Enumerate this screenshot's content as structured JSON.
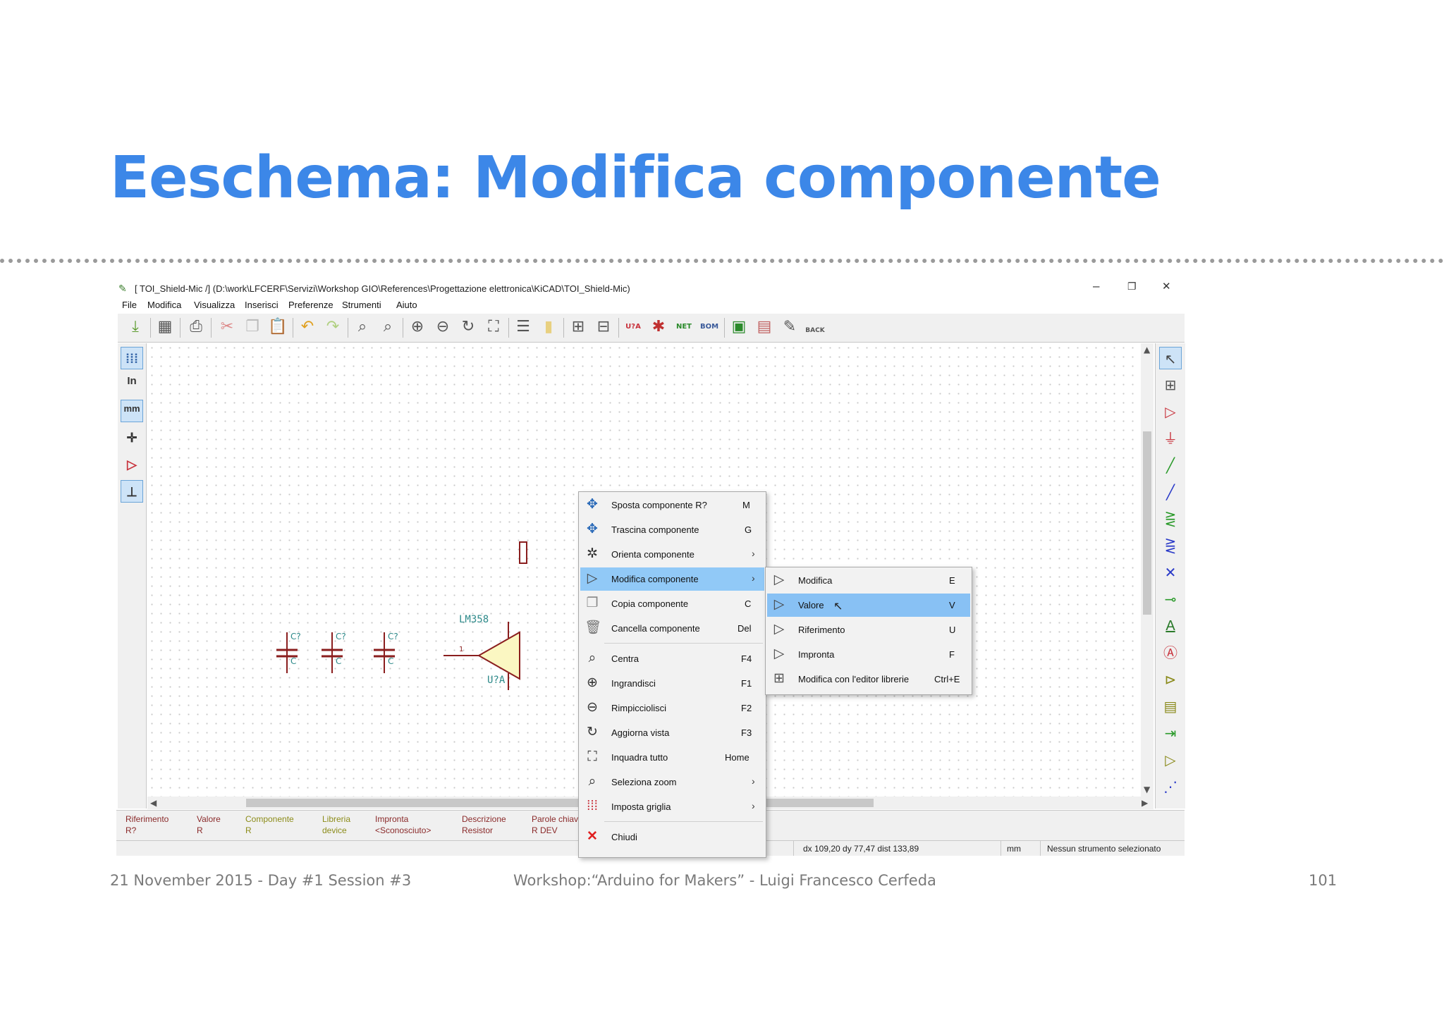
{
  "slide": {
    "title": "Eeschema: Modifica componente",
    "footer_left": "21 November 2015 - Day #1 Session #3",
    "footer_center": "Workshop:“Arduino for Makers” - Luigi Francesco Cerfeda",
    "footer_right": "101"
  },
  "window": {
    "title": "[ TOI_Shield-Mic /] (D:\\work\\LFCERF\\Servizi\\Workshop GIO\\References\\Progettazione elettronica\\KiCAD\\TOI_Shield-Mic)",
    "minimize": "–",
    "restore": "❐",
    "close": "✕"
  },
  "menubar": [
    "File",
    "Modifica",
    "Visualizza",
    "Inserisci",
    "Preferenze",
    "Strumenti",
    "Aiuto"
  ],
  "toolbar": {
    "netlist_label": "NET",
    "bom_label": "BOM",
    "back_label": "BACK",
    "annotate_label": "U?A"
  },
  "left_toolbar": {
    "units_in": "In",
    "units_mm": "mm"
  },
  "schematic": {
    "caps": [
      {
        "ref": "C?",
        "value": "C"
      },
      {
        "ref": "C?",
        "value": "C"
      },
      {
        "ref": "C?",
        "value": "C"
      }
    ],
    "opamp_value": "LM358",
    "opamp_ref": "U?A",
    "pin_number": "1"
  },
  "context_menu": {
    "items": [
      {
        "label": "Sposta componente R?",
        "shortcut": "M"
      },
      {
        "label": "Trascina componente",
        "shortcut": "G"
      },
      {
        "label": "Orienta componente",
        "shortcut": "›"
      },
      {
        "label": "Modifica componente",
        "shortcut": "›"
      },
      {
        "label": "Copia componente",
        "shortcut": "C"
      },
      {
        "label": "Cancella componente",
        "shortcut": "Del"
      },
      {
        "label": "Centra",
        "shortcut": "F4"
      },
      {
        "label": "Ingrandisci",
        "shortcut": "F1"
      },
      {
        "label": "Rimpicciolisci",
        "shortcut": "F2"
      },
      {
        "label": "Aggiorna vista",
        "shortcut": "F3"
      },
      {
        "label": "Inquadra tutto",
        "shortcut": "Home"
      },
      {
        "label": "Seleziona zoom",
        "shortcut": "›"
      },
      {
        "label": "Imposta griglia",
        "shortcut": "›"
      },
      {
        "label": "Chiudi",
        "shortcut": ""
      }
    ]
  },
  "submenu": {
    "items": [
      {
        "label": "Modifica",
        "shortcut": "E"
      },
      {
        "label": "Valore",
        "shortcut": "V"
      },
      {
        "label": "Riferimento",
        "shortcut": "U"
      },
      {
        "label": "Impronta",
        "shortcut": "F"
      },
      {
        "label": "Modifica con l'editor librerie",
        "shortcut": "Ctrl+E"
      }
    ]
  },
  "status": {
    "columns": [
      {
        "label": "Riferimento",
        "value": "R?"
      },
      {
        "label": "Valore",
        "value": "R"
      },
      {
        "label": "Componente",
        "value": "R"
      },
      {
        "label": "Libreria",
        "value": "device"
      },
      {
        "label": "Impronta",
        "value": "<Sconosciuto>"
      },
      {
        "label": "Descrizione",
        "value": "Resistor"
      },
      {
        "label": "Parole chiav",
        "value": "R DEV"
      }
    ],
    "coords": "dx 109,20  dy 77,47  dist 133,89",
    "units": "mm",
    "tool": "Nessun strumento selezionato"
  },
  "colors": {
    "title_blue": "#3c87e8",
    "schematic_red": "#8a1e1e",
    "schematic_teal": "#2e8a8a",
    "highlight": "#91c9f7"
  }
}
